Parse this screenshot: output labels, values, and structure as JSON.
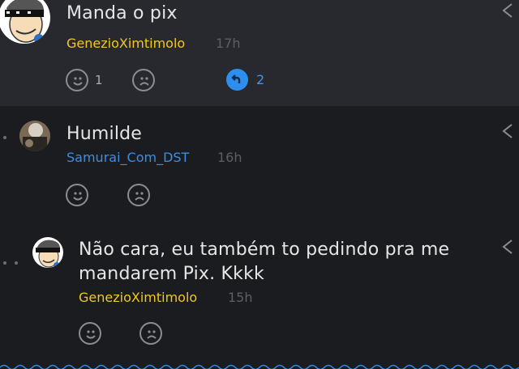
{
  "comments": [
    {
      "body": "Manda o pix",
      "username": "GenezioXimtimolo",
      "time": "17h",
      "likes": "1",
      "replies": "2",
      "avatar": "cartoon-sunglasses-avatar"
    },
    {
      "body": "Humilde",
      "username": "Samurai_Com_DST",
      "time": "16h",
      "avatar": "photo-avatar"
    },
    {
      "body_lines": [
        "Não cara, eu também to pedindo pra me",
        "mandarem Pix. Kkkk"
      ],
      "username": "GenezioXimtimolo",
      "time": "15h",
      "avatar": "cartoon-sunglasses-avatar"
    }
  ],
  "icons": {
    "like": "smile-icon",
    "dislike": "frown-icon",
    "reply": "reply-badge-icon",
    "share": "share-icon"
  },
  "colors": {
    "background": "#1b1c20",
    "highlight_background": "#27292e",
    "username_yellow": "#f3c623",
    "username_blue": "#3a8ee6",
    "reply_accent": "#2d8ef0"
  }
}
